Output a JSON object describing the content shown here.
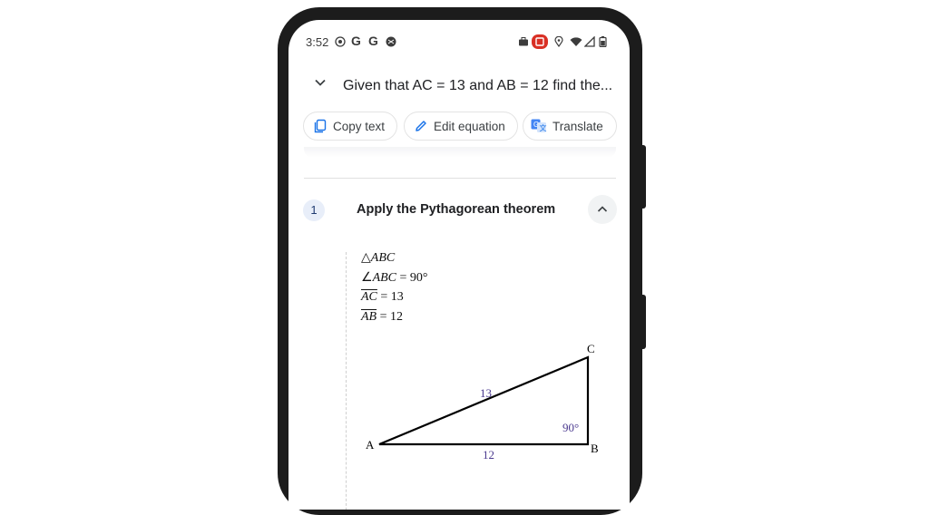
{
  "status_bar": {
    "time": "3:52",
    "g1": "G",
    "g2": "G"
  },
  "header": {
    "query": "Given that AC = 13 and AB = 12 find the..."
  },
  "chips": {
    "copy_text": "Copy text",
    "edit_equation": "Edit equation",
    "translate": "Translate"
  },
  "step": {
    "number": "1",
    "title": "Apply the Pythagorean theorem"
  },
  "given": {
    "triangle": "ABC",
    "angle_name": "ABC",
    "angle_value": " = 90°",
    "ac_name": "AC",
    "ac_value": " = 13",
    "ab_name": "AB",
    "ab_value": " = 12"
  },
  "figure": {
    "vertex_a": "A",
    "vertex_b": "B",
    "vertex_c": "C",
    "side_ac": "13",
    "side_ab": "12",
    "angle_b": "90°"
  },
  "colors": {
    "accent_blue": "#1a73e8",
    "record_red": "#d93025",
    "label_purple": "#4b3a8f"
  },
  "icons": [
    "wifi-icon",
    "signal-icon",
    "battery-icon",
    "location-icon",
    "briefcase-icon",
    "recording-icon",
    "copy-icon",
    "pencil-icon",
    "translate-icon",
    "chevron-down-icon",
    "chevron-up-icon"
  ]
}
